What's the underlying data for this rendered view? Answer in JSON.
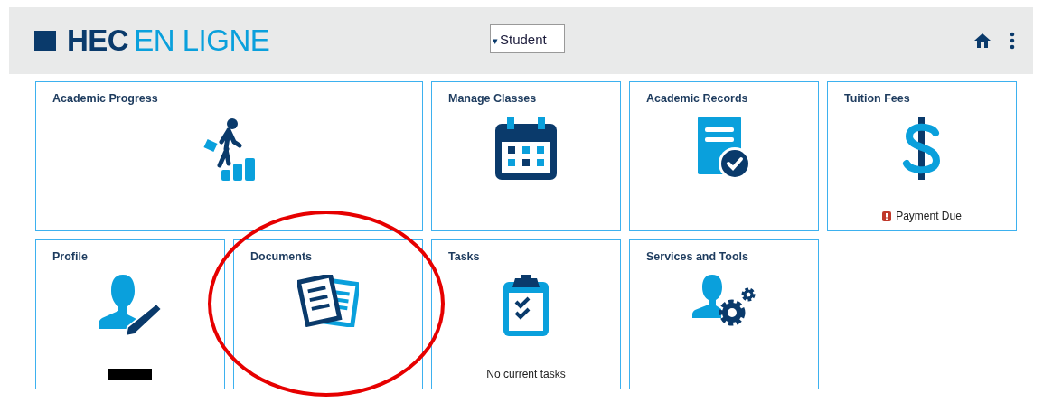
{
  "header": {
    "logo": {
      "bold": "HEC",
      "light": "EN LIGNE"
    },
    "role_select": {
      "caret": "▾",
      "value": "Student"
    }
  },
  "tiles": [
    {
      "title": "Academic Progress",
      "kind": "progress",
      "highlighted": false
    },
    {
      "title": "Manage Classes",
      "kind": "classes",
      "highlighted": false
    },
    {
      "title": "Academic Records",
      "kind": "records",
      "highlighted": false
    },
    {
      "title": "Tuition Fees",
      "kind": "fees",
      "highlighted": false,
      "footer": {
        "kind": "alert",
        "text": "Payment Due"
      }
    },
    {
      "title": "Profile",
      "kind": "profile",
      "highlighted": false,
      "footer": {
        "kind": "redacted"
      }
    },
    {
      "title": "Documents",
      "kind": "documents",
      "highlighted": true
    },
    {
      "title": "Tasks",
      "kind": "tasks",
      "highlighted": false,
      "footer": {
        "kind": "text",
        "text": "No current tasks"
      }
    },
    {
      "title": "Services and Tools",
      "kind": "services",
      "highlighted": false
    }
  ]
}
